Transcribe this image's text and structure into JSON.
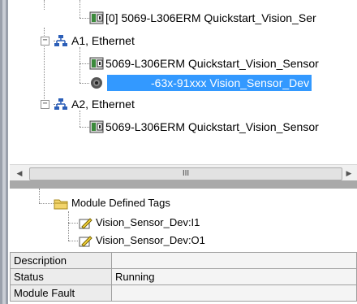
{
  "tree": {
    "items": [
      {
        "label": "[0] 5069-L306ERM Quickstart_Vision_Ser",
        "icon": "controller-module-icon"
      },
      {
        "label": "A1, Ethernet",
        "icon": "ethernet-network-icon",
        "expander": "−"
      },
      {
        "label": "5069-L306ERM Quickstart_Vision_Sensor",
        "icon": "controller-module-icon"
      },
      {
        "label": "-63x-91xxx Vision_Sensor_Dev",
        "icon": "vision-sensor-icon",
        "selected": true
      },
      {
        "label": "A2, Ethernet",
        "icon": "ethernet-network-icon",
        "expander": "−"
      },
      {
        "label": "5069-L306ERM Quickstart_Vision_Sensor",
        "icon": "controller-module-icon"
      }
    ]
  },
  "scrollbar": {
    "left": "◀",
    "right": "▶",
    "grip": "III"
  },
  "tags": {
    "folder": "Module Defined Tags",
    "items": [
      "Vision_Sensor_Dev:I1",
      "Vision_Sensor_Dev:O1"
    ]
  },
  "properties": [
    {
      "key": "Description",
      "value": ""
    },
    {
      "key": "Status",
      "value": "Running"
    },
    {
      "key": "Module Fault",
      "value": ""
    }
  ],
  "colors": {
    "selection": "#3399ff",
    "splitter": "#a9a9a9"
  }
}
